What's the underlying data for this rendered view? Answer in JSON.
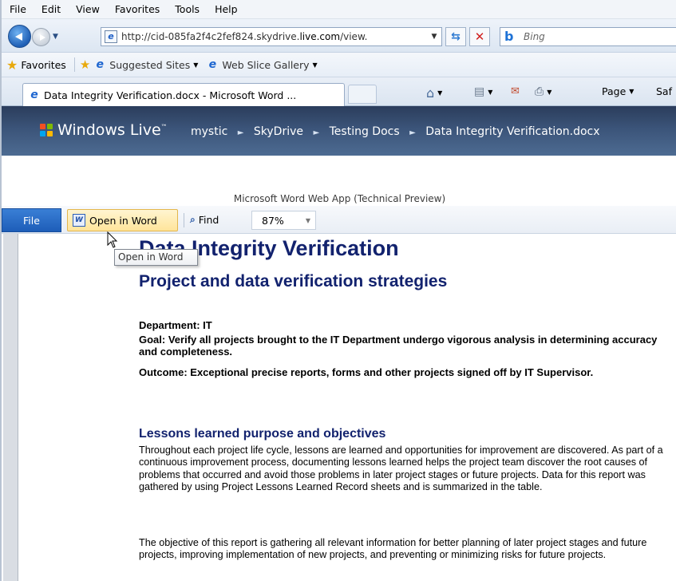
{
  "menu": [
    "File",
    "Edit",
    "View",
    "Favorites",
    "Tools",
    "Help"
  ],
  "nav": {
    "url_prefix": "http://cid-085fa2f4c2fef824.skydrive.",
    "url_domain": "live.com",
    "url_suffix": "/view.",
    "search_placeholder": "Bing",
    "history_dropdown": "▼",
    "refresh_symbol": "⁴₇",
    "stop_symbol": "✕"
  },
  "favorites_bar": {
    "favorites_label": "Favorites",
    "suggested_sites": "Suggested Sites",
    "web_slice_gallery": "Web Slice Gallery"
  },
  "tab": {
    "title": "Data Integrity Verification.docx - Microsoft Word ..."
  },
  "command_bar": {
    "page_label": "Page",
    "safety_label": "Saf"
  },
  "windows_live": {
    "brand": "Windows Live",
    "trademark": "™",
    "breadcrumb": [
      "mystic",
      "SkyDrive",
      "Testing Docs",
      "Data Integrity Verification.docx"
    ]
  },
  "app_title": "Microsoft Word Web App (Technical Preview)",
  "word_toolbar": {
    "file": "File",
    "open_in_word": "Open in Word",
    "find": "Find",
    "zoom": "87%"
  },
  "tooltip": "Open in Word",
  "document": {
    "title": "Data Integrity Verification",
    "subtitle": "Project and data verification strategies",
    "department": "Department:  IT",
    "goal": "Goal:  Verify all projects brought to the IT Department undergo vigorous analysis in determining accuracy and completeness.",
    "outcome": "Outcome:  Exceptional precise reports, forms and other projects signed off by IT Supervisor.",
    "section_heading": "Lessons learned purpose and objectives",
    "paragraph1": "Throughout each project life cycle, lessons are learned and opportunities for improvement are discovered. As part of a continuous improvement process, documenting lessons learned helps the project team discover the root causes of problems that occurred and avoid those problems in later project stages or future projects. Data for this report was gathered by using Project Lessons Learned Record sheets and is summarized in the table.",
    "paragraph2": "The objective of this report is gathering all relevant information for better planning of later project stages and future projects, improving implementation of new projects, and preventing or minimizing risks for future projects."
  },
  "colors": {
    "heading_navy": "#12226e",
    "file_button_blue": "#1e5db8",
    "open_in_word_highlight": "#ffe49a",
    "windows_live_header": "#3b5479"
  }
}
